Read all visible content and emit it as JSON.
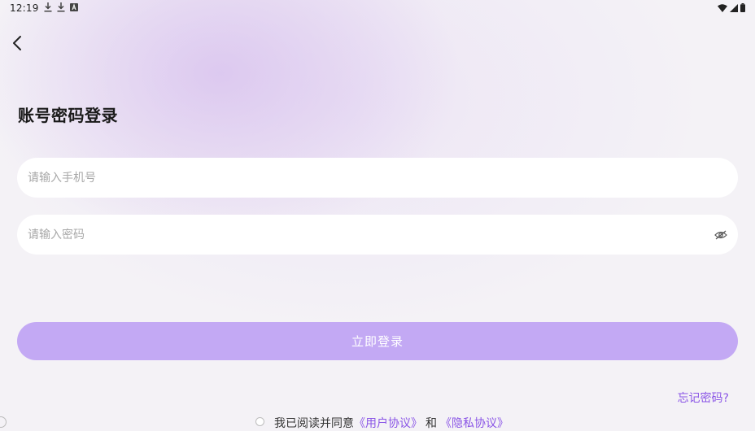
{
  "status_bar": {
    "time": "12:19",
    "left_icons": [
      "download-icon",
      "download-icon",
      "app-a-icon"
    ],
    "right_icons": [
      "wifi-icon",
      "signal-icon",
      "battery-icon"
    ]
  },
  "header": {
    "back_icon": "chevron-left-icon",
    "title": "账号密码登录"
  },
  "form": {
    "phone": {
      "value": "",
      "placeholder": "请输入手机号"
    },
    "password": {
      "value": "",
      "placeholder": "请输入密码",
      "toggle_icon": "eye-hidden-icon"
    },
    "login_label": "立即登录",
    "forgot_label": "忘记密码?"
  },
  "agreement": {
    "prefix": "我已阅读并同意",
    "user_agreement": "《用户协议》",
    "conjunction": "和",
    "privacy_policy": "《隐私协议》"
  },
  "colors": {
    "accent": "#8a55e6",
    "button": "#c3a9f4",
    "background": "#f4f2f6"
  }
}
